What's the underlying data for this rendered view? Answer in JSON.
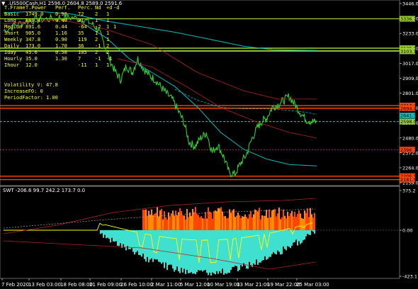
{
  "header": {
    "symbol_title": ".US500Cash,H1  2596.0 2604.8 2589.0 2591.6",
    "indicator_title": "SWT -206.6 99.7 242.2 173.7 0.0"
  },
  "table": {
    "headers": [
      "T.Frame",
      "T.Power",
      "Perf.",
      "Perc.",
      "Nd",
      "+d",
      "-d"
    ],
    "rows": [
      [
        "Basic",
        "1749.0",
        "0.98",
        "72",
        "2",
        "1",
        ""
      ],
      [
        "Long",
        "880.4",
        "0.40",
        "81",
        "1",
        "1",
        ""
      ],
      [
        "Medium",
        "891.6",
        "0.44",
        "-64",
        "-2",
        "1",
        "1"
      ],
      [
        "Short",
        "905.0",
        "1.16",
        "35",
        "1",
        "1",
        ""
      ],
      [
        "Weekly",
        "347.8",
        "0.90",
        "119",
        "2",
        "1",
        ""
      ],
      [
        "Daily",
        "173.0",
        "1.70",
        "36",
        "-1",
        "2",
        ""
      ],
      [
        "Iday",
        "45.6",
        "0.58",
        "105",
        "2",
        "2",
        ""
      ],
      [
        "Hourly",
        "35.0",
        "1.30",
        "7",
        "-1",
        "-1",
        ""
      ],
      [
        "Ihour",
        "12.0",
        "",
        "-11",
        "1",
        "1",
        ""
      ]
    ],
    "volatility": "Volatility V: 47.8",
    "increase": "IncreaseFO: 0",
    "period_factor": "PeriodFactor: 1.00"
  },
  "price_axis": {
    "labels": [
      "3446.0",
      "3338.0",
      "3233.0",
      "3125.0",
      "3017.0",
      "2909.0",
      "2801.0",
      "2693.0",
      "2588.0",
      "2480.0",
      "2372.0",
      "2264.0",
      "2159.0"
    ]
  },
  "price_tags": [
    {
      "text": "3336.7",
      "color": "#9acd32"
    },
    {
      "text": "3125.5",
      "color": "#9acd32"
    },
    {
      "text": "3107.7",
      "color": "#9acd32"
    },
    {
      "text": "3103.1",
      "color": "#9acd32"
    },
    {
      "text": "2713.4",
      "color": "#ff4500"
    },
    {
      "text": "2694.4",
      "color": "#ff4500"
    },
    {
      "text": "2641.3",
      "color": "#00c0c0"
    },
    {
      "text": "2598.0",
      "color": "#9acd32"
    },
    {
      "text": "2396.7",
      "color": "#ff4500"
    },
    {
      "text": "2206.5",
      "color": "#ff4500"
    },
    {
      "text": "2181.5",
      "color": "#ff4500"
    }
  ],
  "indicator_axis": {
    "labels": [
      "375.2",
      "0.00",
      "-423.1"
    ]
  },
  "time_axis": {
    "labels": [
      "7 Feb 2020",
      "13 Feb 03:00",
      "18 Feb 08:00",
      "21 Feb 09:00",
      "26 Feb 10:00",
      "2 Mar 11:00",
      "5 Mar 12:00",
      "10 Mar 19:00",
      "13 Mar 21:00",
      "19 Mar 22:00",
      "25 Mar 03:00"
    ]
  },
  "colors": {
    "price_line": "#32cd32",
    "ma_cyan": "#00bfbf",
    "level_green": "#9acd32",
    "level_red": "#ff4500",
    "histogram_cyan": "#40e0d0",
    "histogram_orange": "#ff8c00",
    "histogram_yellow": "#ffff00"
  }
}
